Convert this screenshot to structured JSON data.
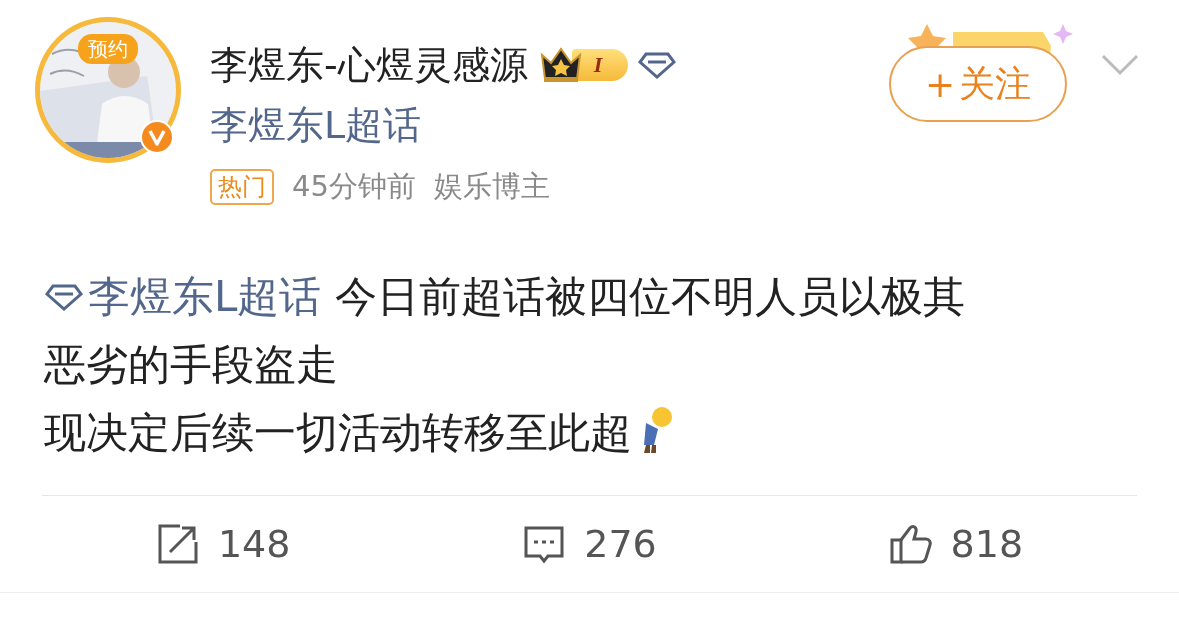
{
  "author": {
    "name": "李煜东-心煜灵感源",
    "avatar_badge": "预约",
    "verified": true,
    "level": "I",
    "topic": "李煜东L超话"
  },
  "meta": {
    "tag": "热门",
    "time": "45分钟前",
    "source": "娱乐博主"
  },
  "follow_button": {
    "plus": "+",
    "label": "关注"
  },
  "post": {
    "topic_link": "李煜东L超话",
    "lines": [
      "今日前超话被四位不明人员以极其",
      "恶劣的手段盗走",
      "现决定后续一切活动转移至此超"
    ]
  },
  "actions": [
    {
      "kind": "repost",
      "count": "148"
    },
    {
      "kind": "comment",
      "count": "276"
    },
    {
      "kind": "like",
      "count": "818"
    }
  ]
}
